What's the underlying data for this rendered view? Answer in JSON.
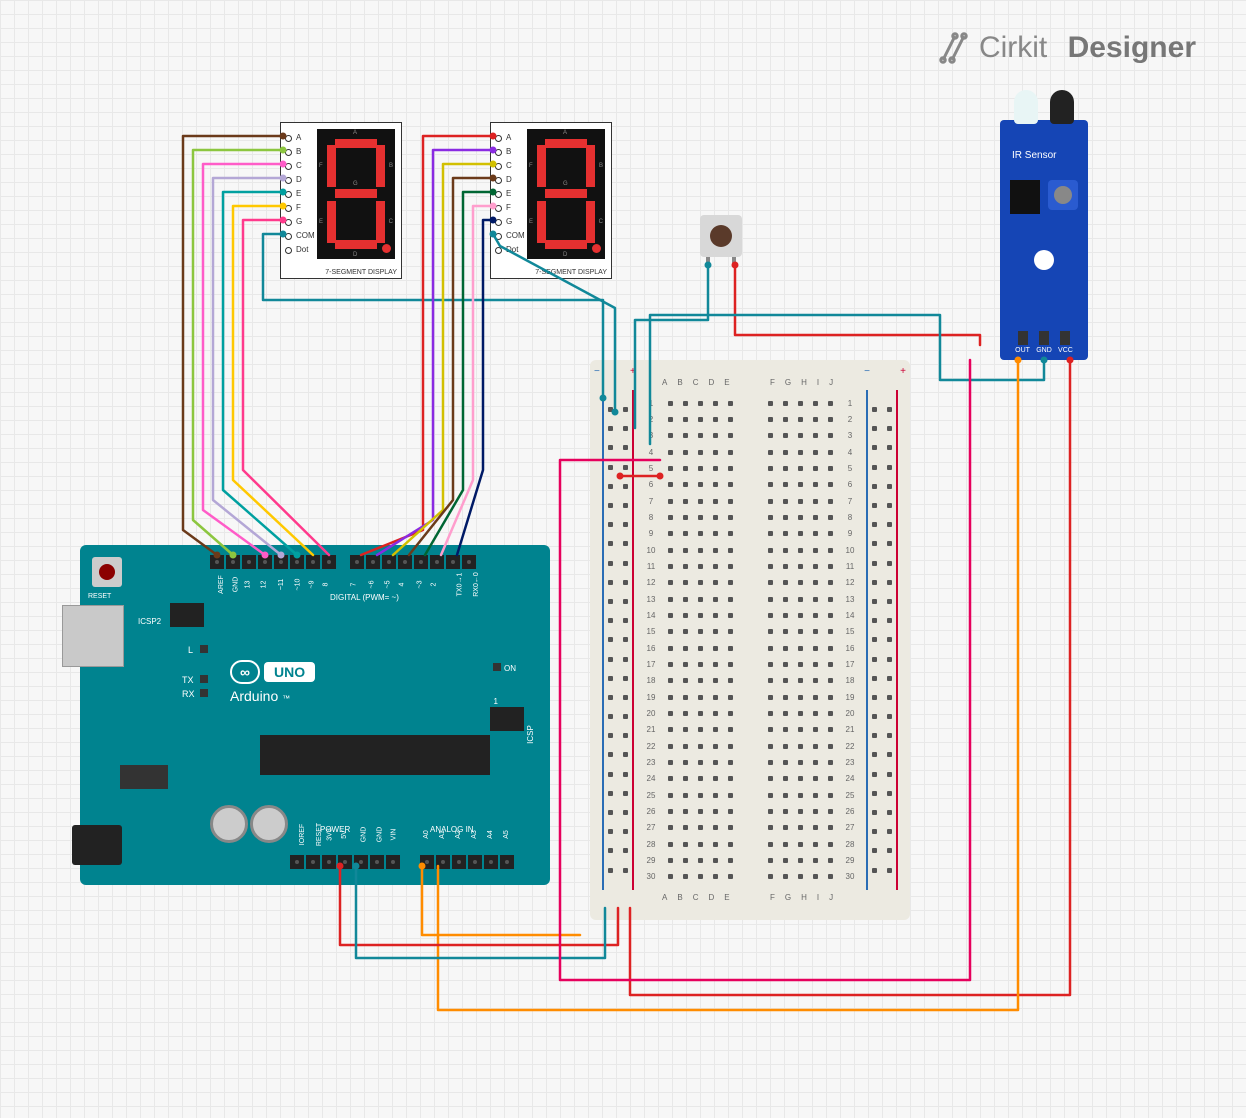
{
  "app": {
    "brand_prefix": "Cirkit",
    "brand_suffix": "Designer"
  },
  "components": {
    "arduino": {
      "title": "Arduino",
      "logo_symbol": "∞",
      "uno_label": "UNO",
      "tm": "™",
      "reset_label": "RESET",
      "icsp2_label": "ICSP2",
      "icsp_label": "ICSP",
      "l_label": "L",
      "tx_label": "TX",
      "rx_label": "RX",
      "on_label": "ON",
      "one_label": "1",
      "digital_section": "DIGITAL (PWM= ~)",
      "analog_section": "ANALOG IN",
      "power_section": "POWER",
      "digital_pins": [
        "AREF",
        "GND",
        "13",
        "12",
        "~11",
        "~10",
        "~9",
        "8",
        "7",
        "~6",
        "~5",
        "4",
        "~3",
        "2",
        "TX0→1",
        "RX0←0"
      ],
      "power_pins": [
        "IOREF",
        "RESET",
        "3V3",
        "5V",
        "GND",
        "GND",
        "VIN"
      ],
      "analog_pins": [
        "A0",
        "A1",
        "A2",
        "A3",
        "A4",
        "A5"
      ]
    },
    "seven_segment": {
      "name": "7-SEGMENT DISPLAY",
      "pins": [
        "A",
        "B",
        "C",
        "D",
        "E",
        "F",
        "G",
        "COM",
        "Dot"
      ],
      "seg_top": "A",
      "seg_right_top": "B",
      "seg_right_bot": "C",
      "seg_bot": "D",
      "seg_left_bot": "E",
      "seg_left_top": "F",
      "seg_mid": "G"
    },
    "breadboard": {
      "columns_left": [
        "A",
        "B",
        "C",
        "D",
        "E"
      ],
      "columns_right": [
        "F",
        "G",
        "H",
        "I",
        "J"
      ],
      "rows": 30,
      "rail_minus": "−",
      "rail_plus": "+"
    },
    "ir_sensor": {
      "title": "IR Sensor",
      "pins": [
        "OUT",
        "GND",
        "VCC"
      ]
    },
    "pushbutton": {
      "name": "Pushbutton"
    }
  },
  "wires": [
    {
      "color": "#6b3a1a",
      "from": "seg1.A",
      "to": "arduino.D13"
    },
    {
      "color": "#8cc63f",
      "from": "seg1.B",
      "to": "arduino.D12"
    },
    {
      "color": "#ff5cc8",
      "from": "seg1.C",
      "to": "arduino.D11"
    },
    {
      "color": "#b4a7d6",
      "from": "seg1.D",
      "to": "arduino.D10"
    },
    {
      "color": "#00a0a0",
      "from": "seg1.E",
      "to": "arduino.D9"
    },
    {
      "color": "#ffc800",
      "from": "seg1.F",
      "to": "arduino.D8_area"
    },
    {
      "color": "#ff3a8c",
      "from": "seg1.G",
      "to": "arduino.D8_area"
    },
    {
      "color": "#118899",
      "from": "seg1.COM",
      "to": "breadboard.rail_gnd"
    },
    {
      "color": "#d22",
      "from": "seg2.A",
      "to": "arduino.D7"
    },
    {
      "color": "#8a2be2",
      "from": "seg2.B",
      "to": "arduino.D6"
    },
    {
      "color": "#d2c000",
      "from": "seg2.C",
      "to": "arduino.D5"
    },
    {
      "color": "#6b3a1a",
      "from": "seg2.D",
      "to": "arduino.D4"
    },
    {
      "color": "#006633",
      "from": "seg2.E",
      "to": "arduino.D3"
    },
    {
      "color": "#ff9ecd",
      "from": "seg2.F",
      "to": "arduino.D2"
    },
    {
      "color": "#001a66",
      "from": "seg2.G",
      "to": "arduino.D2_area"
    },
    {
      "color": "#118899",
      "from": "seg2.COM",
      "to": "breadboard.rail_gnd"
    },
    {
      "color": "#118899",
      "from": "pushbutton.1",
      "to": "breadboard.row3"
    },
    {
      "color": "#d22",
      "from": "pushbutton.2",
      "to": "breadboard.row6"
    },
    {
      "color": "#118899",
      "from": "ir.GND",
      "to": "breadboard.rail_gnd"
    },
    {
      "color": "#d22",
      "from": "ir.VCC",
      "to": "breadboard.rail_5v"
    },
    {
      "color": "#ff8c00",
      "from": "ir.OUT",
      "to": "arduino.A1"
    },
    {
      "color": "#d22",
      "from": "arduino.5V",
      "to": "breadboard.rail_5v"
    },
    {
      "color": "#118899",
      "from": "arduino.GND_power",
      "to": "breadboard.rail_gnd"
    },
    {
      "color": "#ff8c00",
      "from": "arduino.A0",
      "to": "breadboard.row"
    },
    {
      "color": "#e6005c",
      "from": "breadboard.row",
      "to": "ir_area"
    }
  ]
}
